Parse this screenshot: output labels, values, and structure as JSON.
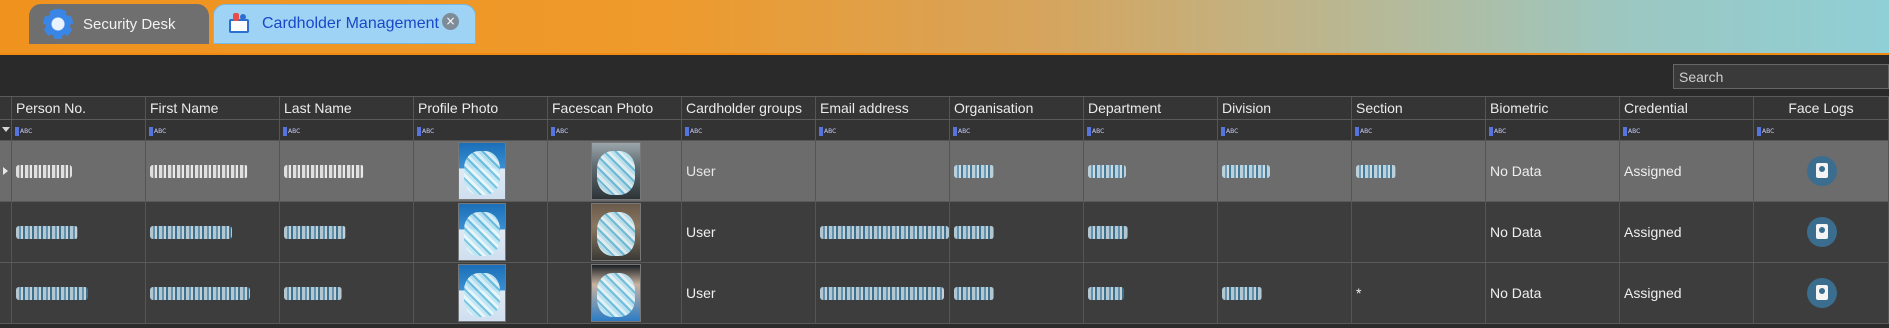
{
  "tabs": [
    {
      "label": "Security Desk",
      "icon": "gear-icon",
      "active": false
    },
    {
      "label": "Cardholder Management",
      "icon": "cardholder-icon",
      "active": true
    }
  ],
  "search": {
    "placeholder": "Search"
  },
  "columns": [
    "Person No.",
    "First Name",
    "Last Name",
    "Profile Photo",
    "Facescan Photo",
    "Cardholder groups",
    "Email address",
    "Organisation",
    "Department",
    "Division",
    "Section",
    "Biometric",
    "Credential",
    "Face Logs"
  ],
  "filter_token": "ABC",
  "rows": [
    {
      "group": "User",
      "section": "",
      "biometric": "No Data",
      "credential": "Assigned"
    },
    {
      "group": "User",
      "section": "",
      "biometric": "No Data",
      "credential": "Assigned"
    },
    {
      "group": "User",
      "section": "*",
      "biometric": "No Data",
      "credential": "Assigned"
    }
  ],
  "colors": {
    "accent_orange": "#f0921e",
    "active_tab": "#9fd3f5",
    "selected_row": "#6c6c6c"
  }
}
